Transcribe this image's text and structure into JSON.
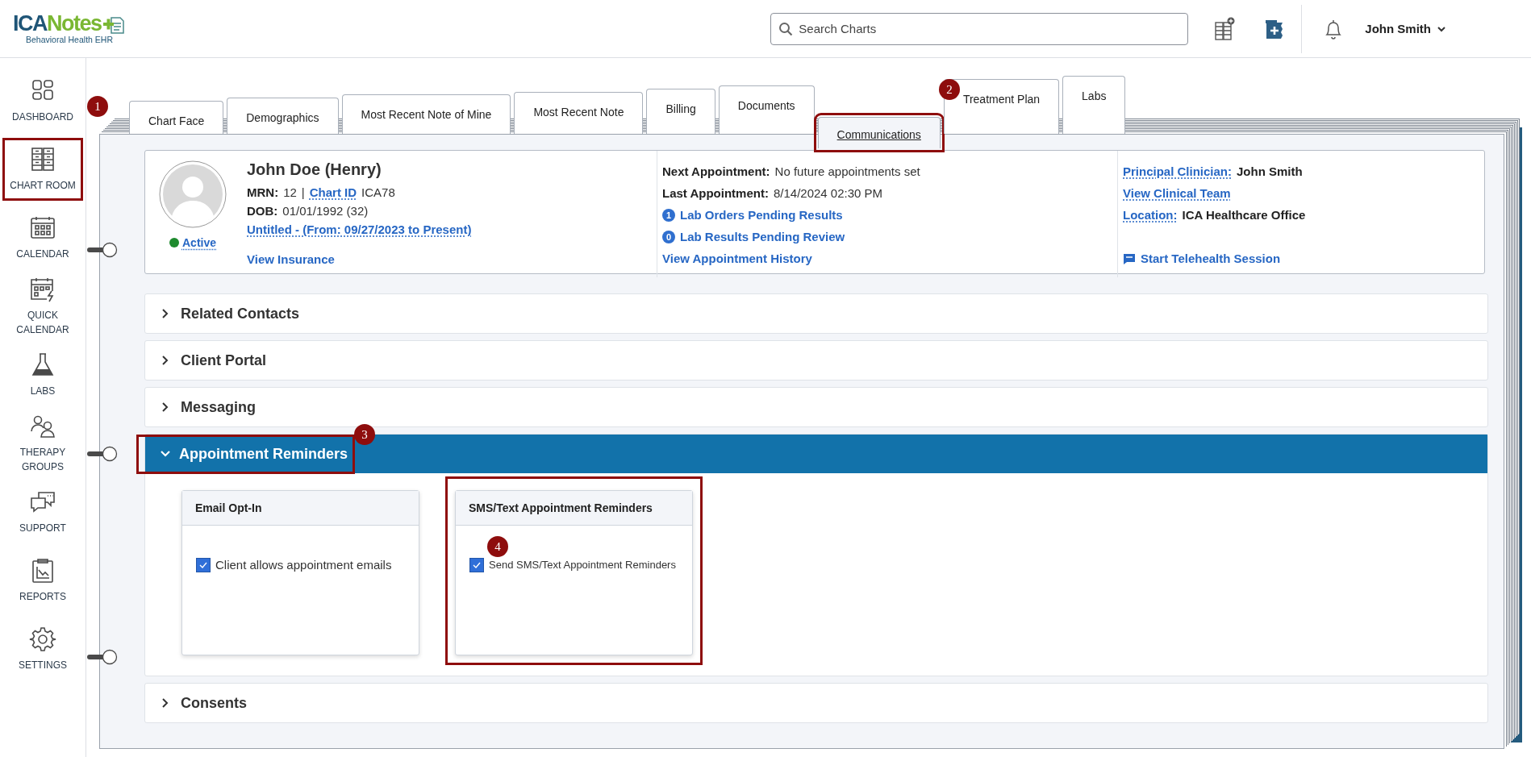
{
  "header": {
    "logo": {
      "primary": "ICA",
      "secondary": "Notes",
      "tagline": "Behavioral Health EHR"
    },
    "search": {
      "placeholder": "Search Charts"
    },
    "user": "John Smith"
  },
  "sidebar": {
    "items": [
      {
        "label": "DASHBOARD",
        "highlighted": false
      },
      {
        "label": "CHART ROOM",
        "highlighted": true
      },
      {
        "label": "CALENDAR",
        "highlighted": false
      },
      {
        "label": "QUICK CALENDAR",
        "highlighted": false
      },
      {
        "label": "LABS",
        "highlighted": false
      },
      {
        "label": "THERAPY GROUPS",
        "highlighted": false
      },
      {
        "label": "SUPPORT",
        "highlighted": false
      },
      {
        "label": "REPORTS",
        "highlighted": false
      },
      {
        "label": "SETTINGS",
        "highlighted": false
      }
    ]
  },
  "tabs": [
    {
      "label": "Chart Face",
      "selected": false,
      "highlighted": false,
      "callout": "1"
    },
    {
      "label": "Demographics",
      "selected": false,
      "highlighted": false
    },
    {
      "label": "Most Recent Note of Mine",
      "selected": false,
      "highlighted": false
    },
    {
      "label": "Most Recent Note",
      "selected": false,
      "highlighted": false
    },
    {
      "label": "Billing",
      "selected": false,
      "highlighted": false
    },
    {
      "label": "Documents",
      "selected": false,
      "highlighted": false
    },
    {
      "label": "Communications",
      "selected": true,
      "highlighted": true,
      "callout": "2"
    },
    {
      "label": "Treatment Plan",
      "selected": false,
      "highlighted": false
    },
    {
      "label": "Labs",
      "selected": false,
      "highlighted": false
    }
  ],
  "patient": {
    "name": "John Doe (Henry)",
    "mrn_label": "MRN:",
    "mrn": "12",
    "separator": "|",
    "chart_id_label": "Chart ID",
    "chart_id": "ICA78",
    "dob_label": "DOB:",
    "dob": "01/01/1992 (32)",
    "episode": "Untitled - (From: 09/27/2023 to Present)",
    "status": {
      "label": "Active",
      "color": "#1e8a2e"
    },
    "insurance_link": "View Insurance",
    "appointments": [
      {
        "label": "Next Appointment:",
        "value": "No future appointments set"
      },
      {
        "label": "Last Appointment:",
        "value": "8/14/2024 02:30 PM"
      }
    ],
    "lab_links": [
      {
        "count": "1",
        "label": "Lab Orders Pending Results"
      },
      {
        "count": "0",
        "label": "Lab Results Pending Review"
      }
    ],
    "history_link": "View Appointment History",
    "principal": {
      "label": "Principal Clinician:",
      "value": "John Smith"
    },
    "team_link": "View Clinical Team",
    "location": {
      "label": "Location:",
      "value": "ICA Healthcare Office"
    },
    "telehealth": "Start Telehealth Session"
  },
  "sections": [
    {
      "title": "Related Contacts",
      "expanded": false,
      "highlighted": false
    },
    {
      "title": "Client Portal",
      "expanded": false,
      "highlighted": false
    },
    {
      "title": "Messaging",
      "expanded": false,
      "highlighted": false
    },
    {
      "title": "Appointment Reminders",
      "expanded": true,
      "highlighted": true,
      "callout": "3",
      "cards": [
        {
          "title": "Email Opt-In",
          "highlighted": false,
          "option": {
            "label": "Client allows appointment emails",
            "checked": true
          }
        },
        {
          "title": "SMS/Text Appointment Reminders",
          "highlighted": true,
          "callout": "4",
          "option": {
            "label": "Send SMS/Text Appointment Reminders",
            "checked": true
          }
        }
      ]
    },
    {
      "title": "Consents",
      "expanded": false,
      "highlighted": false
    }
  ]
}
